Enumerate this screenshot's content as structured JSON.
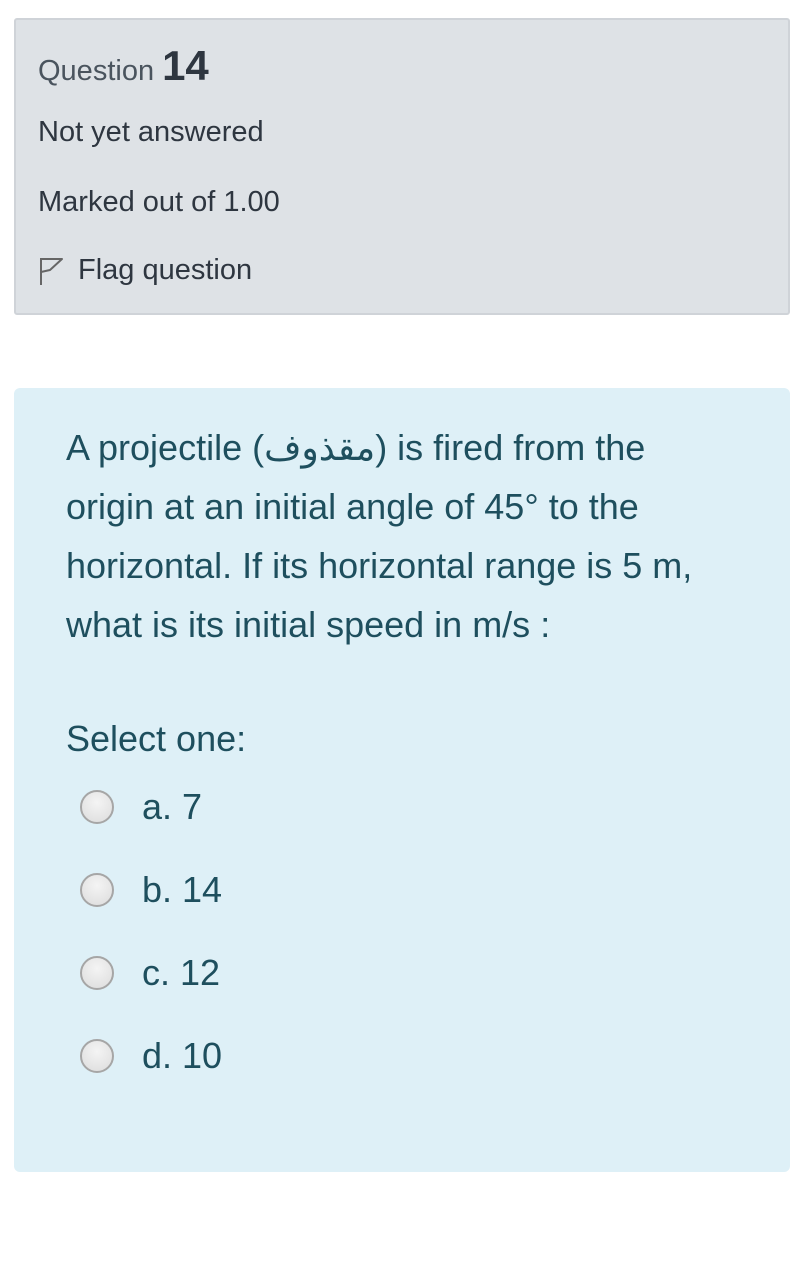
{
  "info": {
    "question_word": "Question",
    "question_number": "14",
    "state": "Not yet answered",
    "grade": "Marked out of 1.00",
    "flag_label": "Flag question"
  },
  "question": {
    "text": "A projectile (مقذوف) is fired from the origin at an initial angle of 45° to the horizontal. If its horizontal range is 5 m, what is its initial speed in m/s  :",
    "prompt": "Select one:",
    "options": [
      {
        "label": "a. 7",
        "selected": false
      },
      {
        "label": "b. 14",
        "selected": false
      },
      {
        "label": "c. 12",
        "selected": false
      },
      {
        "label": "d. 10",
        "selected": false
      }
    ]
  },
  "colors": {
    "info_background": "#dee2e6",
    "content_background": "#def0f7",
    "question_text": "#1e4f5e"
  }
}
